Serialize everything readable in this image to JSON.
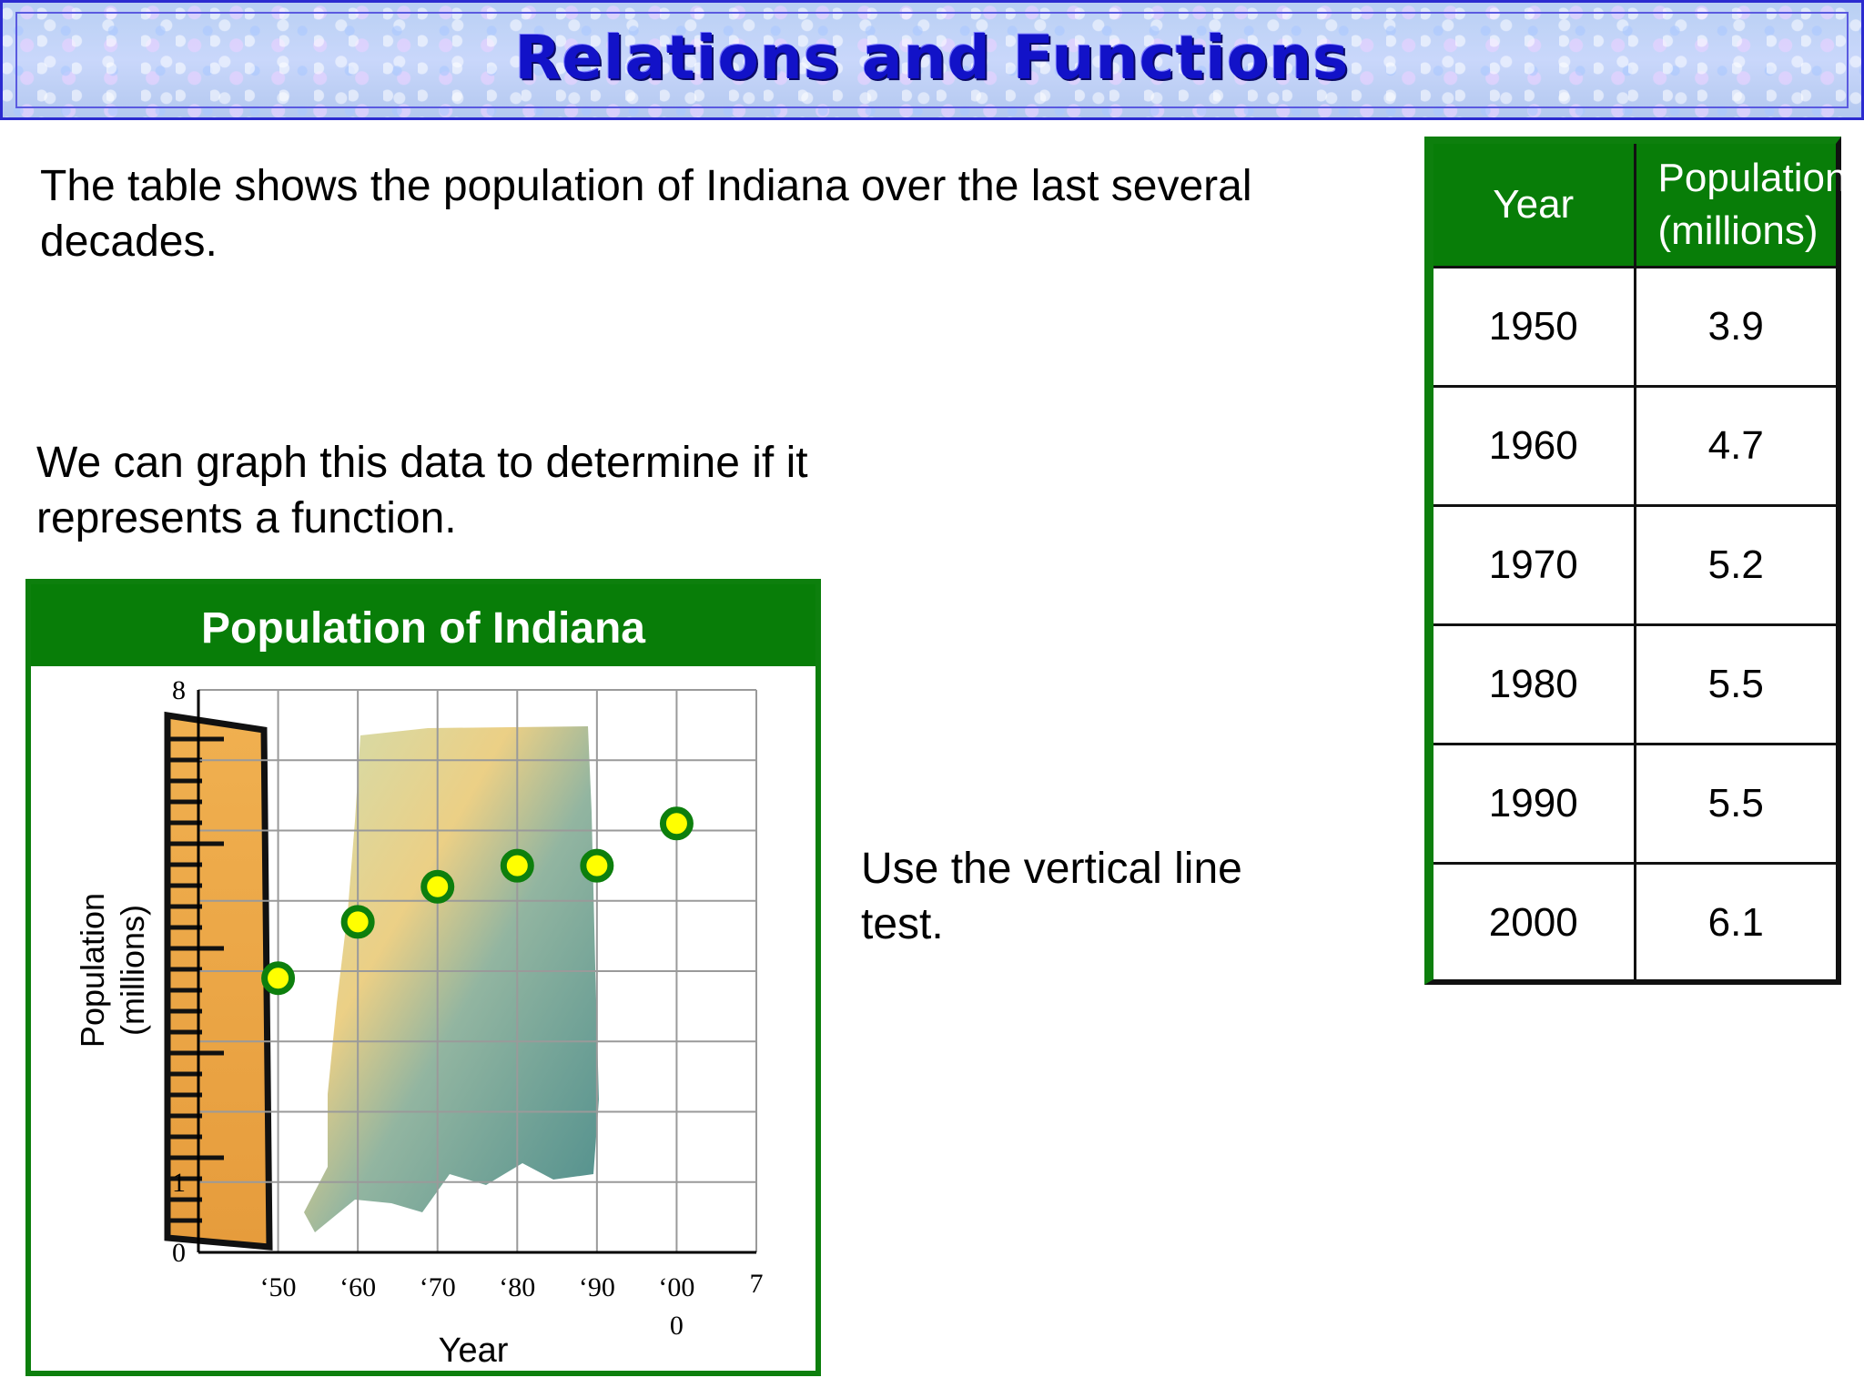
{
  "slide": {
    "title": "Relations and Functions",
    "intro": "The table shows the population of Indiana over the last several decades.",
    "graph_text": "We can graph this data to determine if it represents a function.",
    "vertical_test": "Use the vertical line test."
  },
  "table": {
    "headers": [
      "Year",
      "Population (millions)"
    ],
    "rows": [
      [
        "1950",
        "3.9"
      ],
      [
        "1960",
        "4.7"
      ],
      [
        "1970",
        "5.2"
      ],
      [
        "1980",
        "5.5"
      ],
      [
        "1990",
        "5.5"
      ],
      [
        "2000",
        "6.1"
      ]
    ]
  },
  "chart_data": {
    "type": "scatter",
    "title": "Population of Indiana",
    "xlabel": "Year",
    "ylabel": "Population (millions)",
    "x_ticks": [
      "‘50",
      "‘60",
      "‘70",
      "‘80",
      "‘90",
      "‘00"
    ],
    "x_tick_extra": [
      "7",
      "0"
    ],
    "y_ticks": [
      "0",
      "1",
      "8"
    ],
    "ylim": [
      0,
      8
    ],
    "x": [
      1950,
      1960,
      1970,
      1980,
      1990,
      2000
    ],
    "y": [
      3.9,
      4.7,
      5.2,
      5.5,
      5.5,
      6.1
    ],
    "grid": true,
    "colors": {
      "header": "#087d08",
      "point_fill": "#ffff00",
      "point_stroke": "#0d7f0d"
    }
  }
}
